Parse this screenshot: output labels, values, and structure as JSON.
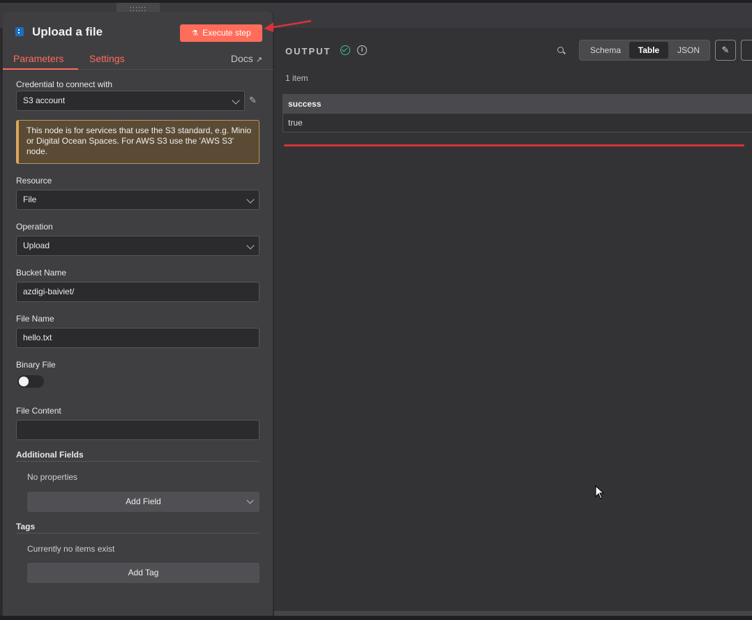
{
  "header": {
    "drag_handle": "::::::",
    "title": "Upload a file",
    "execute_label": "Execute step"
  },
  "tabs": {
    "parameters": "Parameters",
    "settings": "Settings",
    "docs": "Docs"
  },
  "credential": {
    "label": "Credential to connect with",
    "value": "S3 account"
  },
  "notice": "This node is for services that use the S3 standard, e.g. Minio or Digital Ocean Spaces. For AWS S3 use the 'AWS S3' node.",
  "resource": {
    "label": "Resource",
    "value": "File"
  },
  "operation": {
    "label": "Operation",
    "value": "Upload"
  },
  "bucket": {
    "label": "Bucket Name",
    "value": "azdigi-baiviet/"
  },
  "file_name": {
    "label": "File Name",
    "value": "hello.txt"
  },
  "binary_file": {
    "label": "Binary File",
    "enabled": false
  },
  "file_content": {
    "label": "File Content",
    "value": ""
  },
  "additional_fields": {
    "label": "Additional Fields",
    "empty": "No properties",
    "add_label": "Add Field"
  },
  "tags": {
    "label": "Tags",
    "empty": "Currently no items exist",
    "add_label": "Add Tag"
  },
  "output": {
    "title": "OUTPUT",
    "views": {
      "schema": "Schema",
      "table": "Table",
      "json": "JSON"
    },
    "active_view": "Table",
    "item_count": "1 item",
    "columns": [
      "success"
    ],
    "rows": [
      [
        "true"
      ]
    ]
  },
  "colors": {
    "accent": "#ff6d5a",
    "success": "#41c08b",
    "annotation_red": "#d8333a"
  }
}
